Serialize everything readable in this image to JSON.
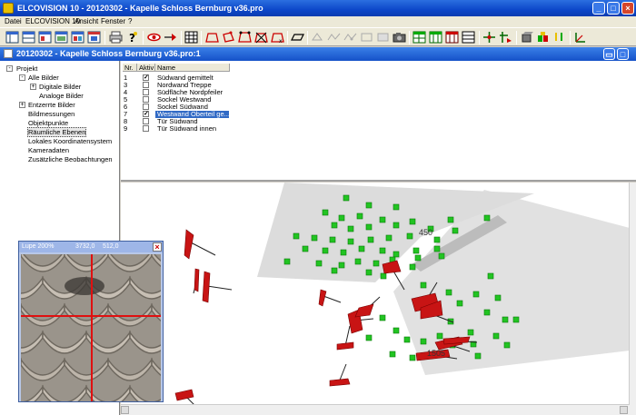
{
  "window": {
    "title": "ELCOVISION 10 - 20120302 - Kapelle Schloss Bernburg v36.pro"
  },
  "menu": [
    "Datei",
    "ELCOVISION 10",
    "Ansicht",
    "Fenster",
    "?"
  ],
  "document": {
    "title": "20120302 - Kapelle Schloss Bernburg v36.pro:1"
  },
  "tree": {
    "root": "Projekt",
    "items": [
      {
        "label": "Alle Bilder",
        "level": 1,
        "expander": "-"
      },
      {
        "label": "Digitale Bilder",
        "level": 2,
        "expander": "+"
      },
      {
        "label": "Analoge Bilder",
        "level": 2,
        "expander": ""
      },
      {
        "label": "Entzerrte Bilder",
        "level": 1,
        "expander": "+"
      },
      {
        "label": "Bildmessungen",
        "level": 1,
        "expander": ""
      },
      {
        "label": "Objektpunkte",
        "level": 1,
        "expander": ""
      },
      {
        "label": "Räumliche Ebenen",
        "level": 1,
        "expander": "",
        "selected": true
      },
      {
        "label": "Lokales Koordinatensystem",
        "level": 1,
        "expander": ""
      },
      {
        "label": "Kameradaten",
        "level": 1,
        "expander": ""
      },
      {
        "label": "Zusätzliche Beobachtungen",
        "level": 1,
        "expander": ""
      }
    ]
  },
  "planes_table": {
    "headers": [
      "Nr.",
      "Aktiv",
      "Name"
    ],
    "rows": [
      {
        "nr": "1",
        "active": true,
        "name": "Südwand gemittelt"
      },
      {
        "nr": "3",
        "active": false,
        "name": "Nordwand Treppe"
      },
      {
        "nr": "4",
        "active": false,
        "name": "Südfläche Nordpfeiler"
      },
      {
        "nr": "5",
        "active": false,
        "name": "Sockel Westwand"
      },
      {
        "nr": "6",
        "active": false,
        "name": "Sockel Südwand"
      },
      {
        "nr": "7",
        "active": true,
        "name": "Westwand Oberteil ge...",
        "selected": true
      },
      {
        "nr": "8",
        "active": false,
        "name": "Tür Südwand"
      },
      {
        "nr": "9",
        "active": false,
        "name": "Tür Südwand innen"
      }
    ]
  },
  "view3d": {
    "labels": [
      "450",
      "1505"
    ],
    "plane_color": "#dcdcdc",
    "point_color": "#22c422",
    "camera_color": "#c81414"
  },
  "lupe": {
    "zoom_label": "Lupe 200%",
    "coord_x": "3732,0",
    "coord_y": "512,0",
    "crosshair_color": "#e01010"
  },
  "colors": {
    "titlebar": "#0d47c9",
    "selection": "#316ac5"
  }
}
